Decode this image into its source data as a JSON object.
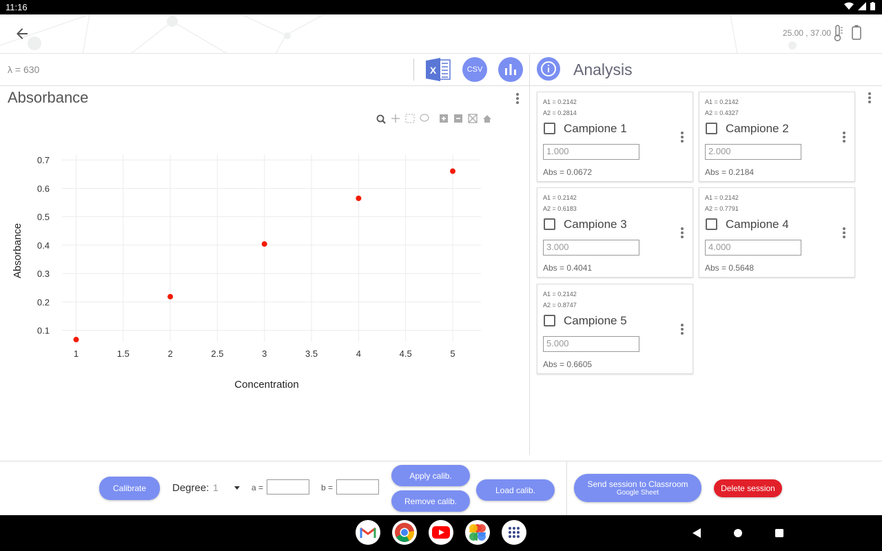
{
  "status_bar": {
    "time": "11:16"
  },
  "header": {
    "temperatures": "25.00 ,  37.00"
  },
  "toolbar": {
    "lambda": "λ = 630",
    "csv_label": "CSV"
  },
  "chart_panel": {
    "title": "Absorbance"
  },
  "chart_data": {
    "type": "scatter",
    "xlabel": "Concentration",
    "ylabel": "Absorbance",
    "x": [
      1,
      2,
      3,
      4,
      5
    ],
    "y": [
      0.0672,
      0.2184,
      0.4041,
      0.5648,
      0.6605
    ],
    "xticks": [
      "1",
      "1.5",
      "2",
      "2.5",
      "3",
      "3.5",
      "4",
      "4.5",
      "5"
    ],
    "yticks": [
      "0.1",
      "0.2",
      "0.3",
      "0.4",
      "0.5",
      "0.6",
      "0.7"
    ],
    "xlim": [
      0.85,
      5.3
    ],
    "ylim": [
      0.06,
      0.72
    ],
    "grid": true,
    "marker_color": "#f21b05"
  },
  "analysis": {
    "title": "Analysis",
    "samples": [
      {
        "a1": "A1 = 0.2142",
        "a2": "A2 = 0.2814",
        "name": "Campione 1",
        "concentration": "1.000",
        "abs": "Abs = 0.0672"
      },
      {
        "a1": "A1 = 0.2142",
        "a2": "A2 = 0.4327",
        "name": "Campione 2",
        "concentration": "2.000",
        "abs": "Abs = 0.2184"
      },
      {
        "a1": "A1 = 0.2142",
        "a2": "A2 = 0.6183",
        "name": "Campione 3",
        "concentration": "3.000",
        "abs": "Abs = 0.4041"
      },
      {
        "a1": "A1 = 0.2142",
        "a2": "A2 = 0.7791",
        "name": "Campione 4",
        "concentration": "4.000",
        "abs": "Abs = 0.5648"
      },
      {
        "a1": "A1 = 0.2142",
        "a2": "A2 = 0.8747",
        "name": "Campione 5",
        "concentration": "5.000",
        "abs": "Abs = 0.6605"
      }
    ]
  },
  "bottom": {
    "calibrate": "Calibrate",
    "degree_label": "Degree:",
    "degree_value": "1",
    "a_label": "a =",
    "b_label": "b =",
    "apply_calib": "Apply calib.",
    "remove_calib": "Remove calib.",
    "load_calib": "Load calib.",
    "send_session": "Send session to Classroom",
    "send_session_sub": "Google Sheet",
    "delete_session": "Delete session"
  },
  "colors": {
    "accent": "#7b8ff2",
    "danger": "#e2202a",
    "marker": "#f21b05"
  }
}
